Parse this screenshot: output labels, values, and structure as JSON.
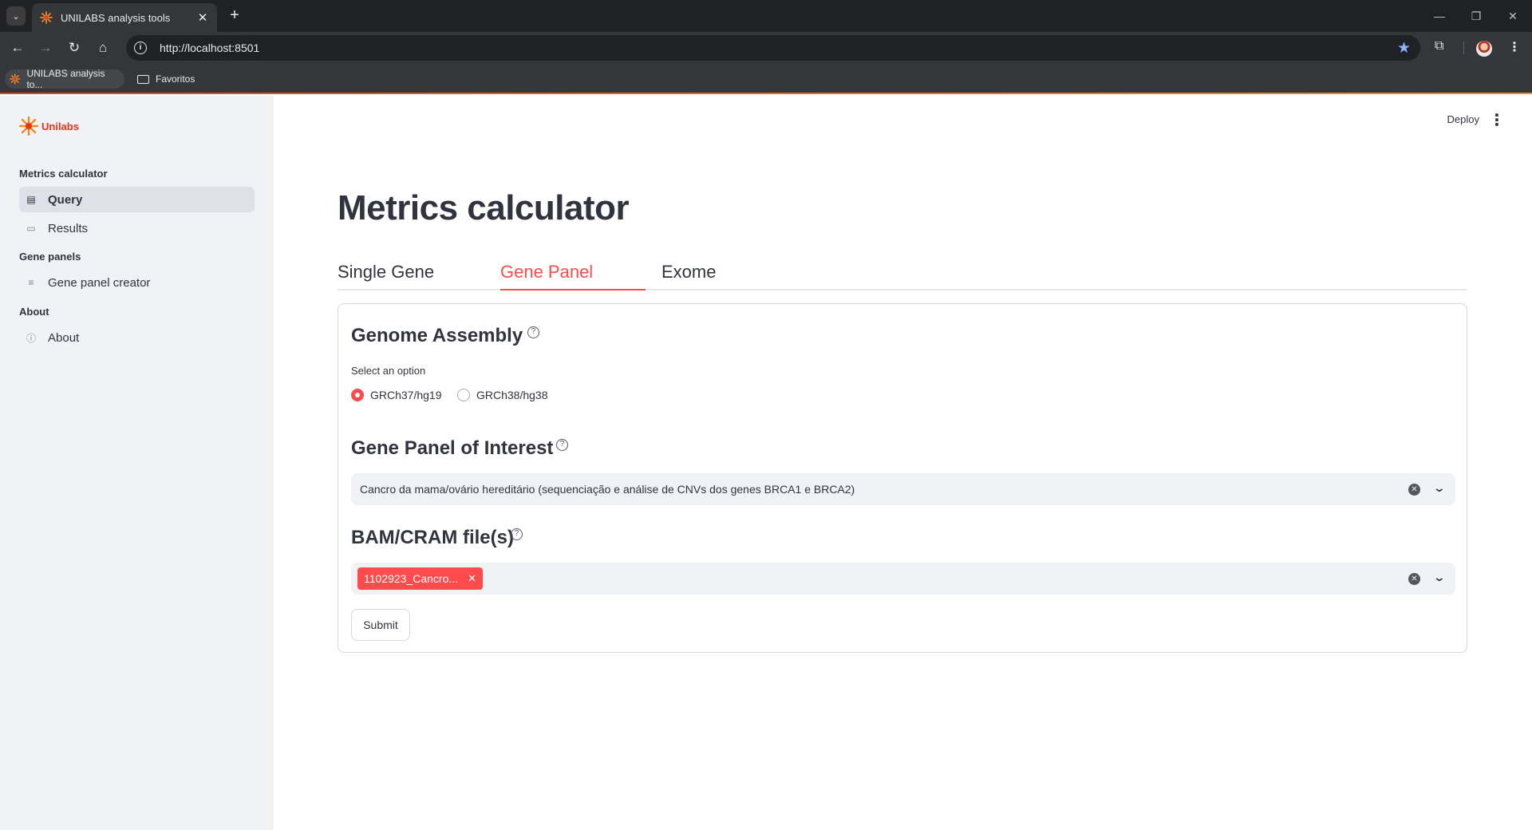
{
  "browser": {
    "tab_title": "UNILABS analysis tools",
    "url": "http://localhost:8501",
    "bookmarks": [
      "UNILABS analysis to...",
      "Favoritos"
    ]
  },
  "sidebar": {
    "brand": "Unilabs",
    "sections": [
      {
        "label": "Metrics calculator",
        "items": [
          {
            "label": "Query",
            "icon": "table-icon",
            "active": true
          },
          {
            "label": "Results",
            "icon": "chart-icon",
            "active": false
          }
        ]
      },
      {
        "label": "Gene panels",
        "items": [
          {
            "label": "Gene panel creator",
            "icon": "edit-list-icon",
            "active": false
          }
        ]
      },
      {
        "label": "About",
        "items": [
          {
            "label": "About",
            "icon": "info-icon",
            "active": false
          }
        ]
      }
    ]
  },
  "header": {
    "deploy": "Deploy"
  },
  "main": {
    "title": "Metrics calculator",
    "tabs": [
      "Single Gene",
      "Gene Panel",
      "Exome"
    ],
    "active_tab": "Gene Panel",
    "form": {
      "assembly_heading": "Genome Assembly",
      "assembly_label": "Select an option",
      "assembly_options": [
        "GRCh37/hg19",
        "GRCh38/hg38"
      ],
      "assembly_selected": "GRCh37/hg19",
      "panel_heading": "Gene Panel of Interest",
      "panel_value": "Cancro da mama/ovário hereditário (sequenciação e análise de CNVs dos genes BRCA1 e BRCA2)",
      "files_heading": "BAM/CRAM file(s)",
      "files_selected": [
        "1102923_Cancro..."
      ],
      "submit_label": "Submit"
    }
  },
  "colors": {
    "accent": "#ff4b4b",
    "sidebar_bg": "#f0f2f6",
    "brand": "#e8321e"
  }
}
